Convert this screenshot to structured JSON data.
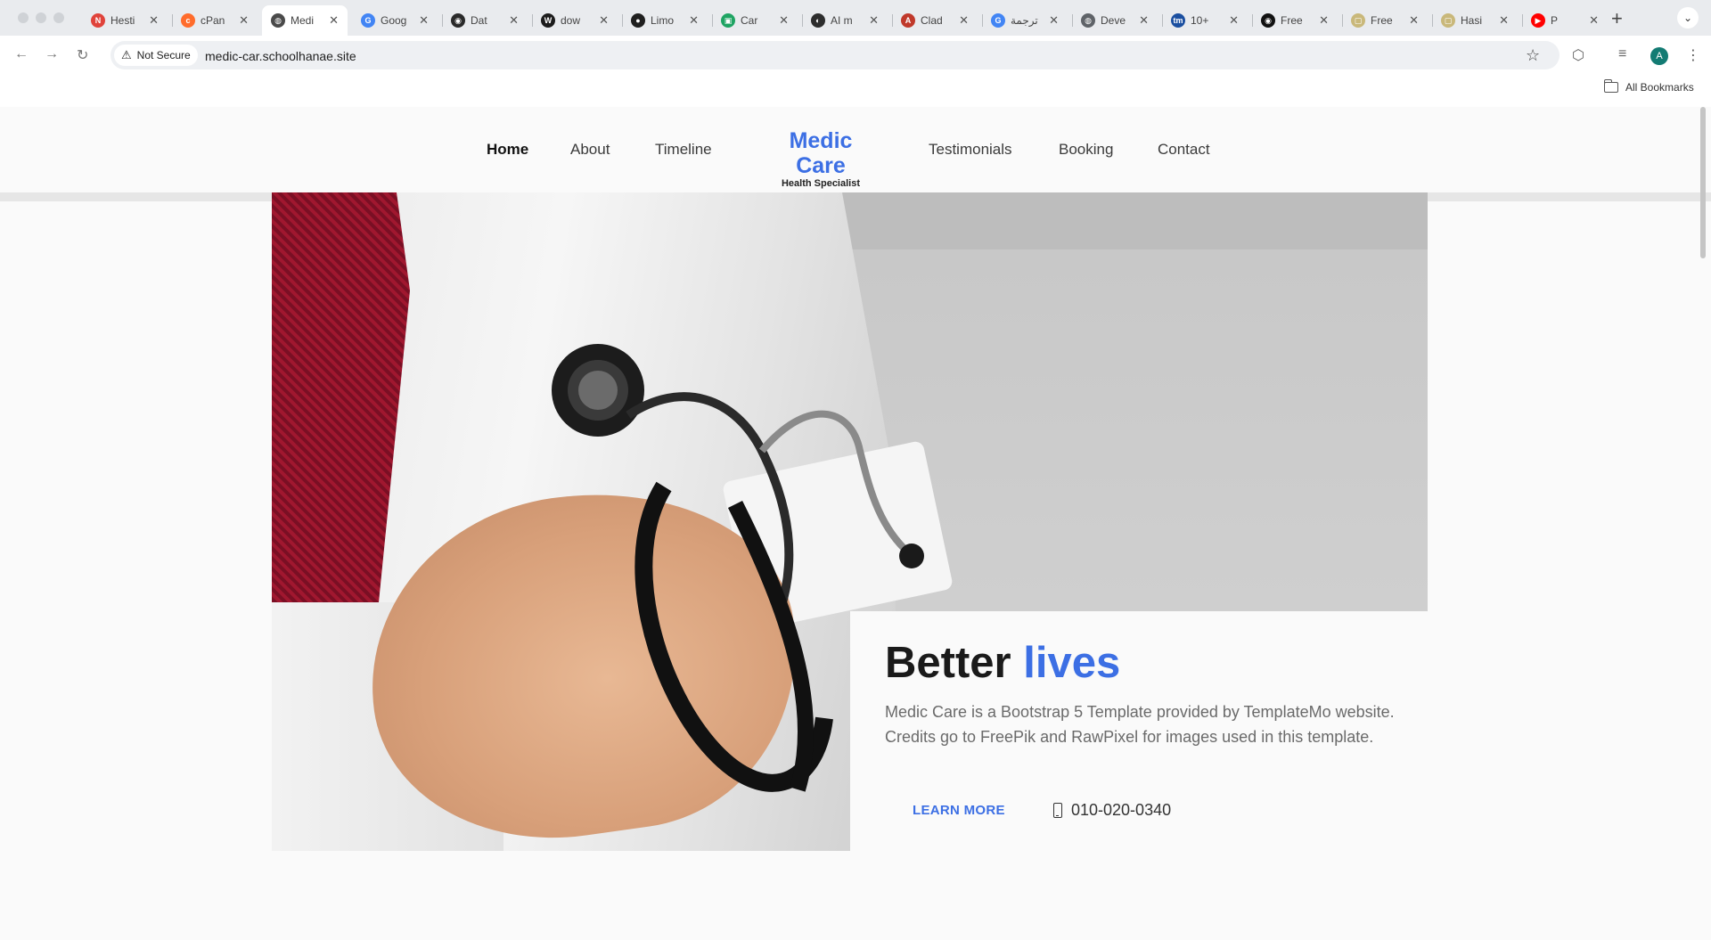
{
  "browser": {
    "tabs": [
      {
        "title": "Hesti",
        "color": "#e0433b",
        "glyph": "N"
      },
      {
        "title": "cPan",
        "color": "#ff6c2c",
        "glyph": "c"
      },
      {
        "title": "Medi",
        "color": "#4a4a4a",
        "glyph": "◍",
        "active": true
      },
      {
        "title": "Goog",
        "color": "#4285f4",
        "glyph": "G"
      },
      {
        "title": "Dat",
        "color": "#2a2a2a",
        "glyph": "◉"
      },
      {
        "title": "dow",
        "color": "#1c1c1c",
        "glyph": "W"
      },
      {
        "title": "Limo",
        "color": "#1f1f1f",
        "glyph": "●"
      },
      {
        "title": "Car",
        "color": "#1fa463",
        "glyph": "▣"
      },
      {
        "title": "AI m",
        "color": "#2d2d2d",
        "glyph": "◐"
      },
      {
        "title": "Clad",
        "color": "#c0392b",
        "glyph": "A"
      },
      {
        "title": "ترجمة",
        "color": "#4285f4",
        "glyph": "G"
      },
      {
        "title": "Deve",
        "color": "#5f6368",
        "glyph": "◍"
      },
      {
        "title": "10+",
        "color": "#1b4fa0",
        "glyph": "tm"
      },
      {
        "title": "Free",
        "color": "#111111",
        "glyph": "◉"
      },
      {
        "title": "Free",
        "color": "#c9b87a",
        "glyph": "▢"
      },
      {
        "title": "Hasi",
        "color": "#c9b87a",
        "glyph": "▢"
      },
      {
        "title": "P",
        "color": "#ff0000",
        "glyph": "▶"
      }
    ],
    "new_tab_icon": "plus-icon",
    "tab_menu_icon": "chevron-down-icon",
    "security_label": "Not Secure",
    "url": "medic-car.schoolhanae.site",
    "all_bookmarks": "All Bookmarks",
    "profile_initial": "A"
  },
  "site": {
    "nav": {
      "items_left": [
        "Home",
        "About",
        "Timeline"
      ],
      "items_right": [
        "Testimonials",
        "Booking",
        "Contact"
      ],
      "active": "Home"
    },
    "brand": {
      "title": "Medic Care",
      "subtitle": "Health Specialist"
    },
    "hero": {
      "title_plain": "Better ",
      "title_accent": "lives",
      "description": "Medic Care is a Bootstrap 5 Template provided by TemplateMo website. Credits go to FreePik and RawPixel for images used in this template.",
      "cta_label": "LEARN MORE",
      "phone": "010-020-0340"
    }
  },
  "colors": {
    "accent": "#3c6fe4",
    "text_dark": "#1a1a1a",
    "text_muted": "#6a6a6a"
  }
}
